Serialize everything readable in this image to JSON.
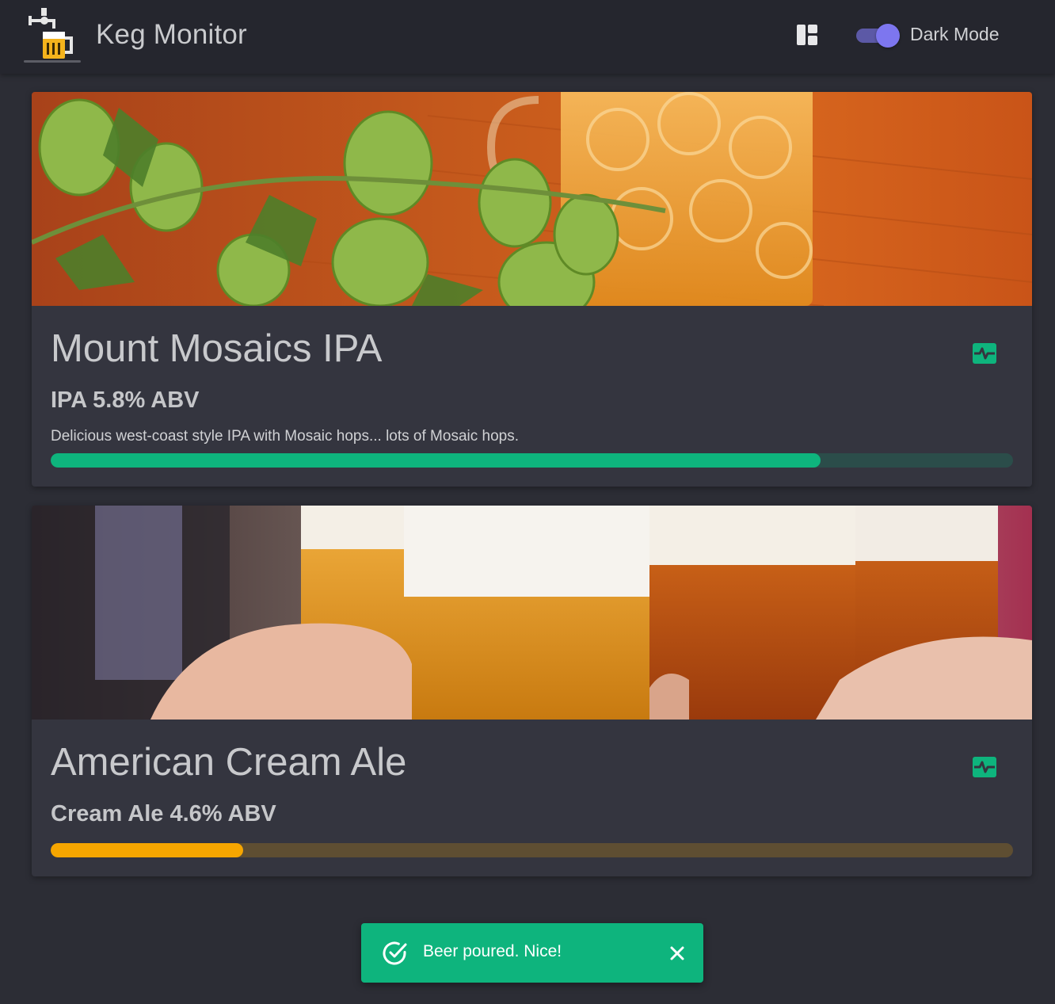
{
  "header": {
    "title": "Keg Monitor",
    "logo_icon": "beer-tap-icon",
    "layout_icon": "dashboard-layout-icon",
    "dark_mode_label": "Dark Mode",
    "dark_mode_on": true
  },
  "kegs": [
    {
      "name": "Mount Mosaics IPA",
      "subtitle": "IPA 5.8% ABV",
      "description": "Delicious west-coast style IPA with Mosaic hops... lots of Mosaic hops.",
      "level": 0.8,
      "color": "#0eb47d",
      "track_color": "#2b4d4a",
      "image": "hops-and-beer-mug",
      "action_icon": "pulse-icon"
    },
    {
      "name": "American Cream Ale",
      "subtitle": "Cream Ale 4.6% ABV",
      "description": "",
      "level": 0.2,
      "color": "#f6a600",
      "track_color": "#5e4e32",
      "image": "toasting-beer-glasses",
      "action_icon": "pulse-icon"
    }
  ],
  "toast": {
    "message": "Beer poured. Nice!",
    "icon": "check-circle-icon",
    "close_icon": "close-icon",
    "color": "#0eb47d"
  }
}
